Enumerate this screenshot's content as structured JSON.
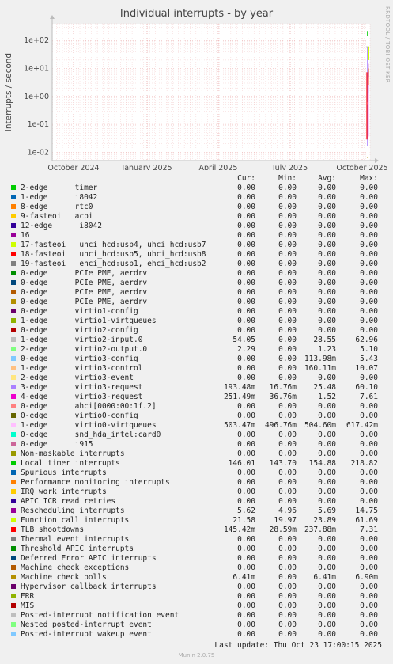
{
  "chart_data": {
    "type": "line",
    "title": "Individual interrupts - by year",
    "ylabel": "interrupts / second",
    "yscale": "log",
    "ylim": [
      0.005,
      400
    ],
    "y_ticks": [
      "1e+02",
      "1e+01",
      "1e+00",
      "1e-01",
      "1e-02"
    ],
    "x_ticks": [
      "October 2024",
      "January 2025",
      "April 2025",
      "July 2025",
      "October 2025"
    ],
    "columns": [
      "Cur:",
      "Min:",
      "Avg:",
      "Max:"
    ],
    "series": [
      {
        "name": "2-edge      timer",
        "color": "#00cc00",
        "cur": "0.00",
        "min": "0.00",
        "avg": "0.00",
        "max": "0.00"
      },
      {
        "name": "1-edge      i8042",
        "color": "#0066b3",
        "cur": "0.00",
        "min": "0.00",
        "avg": "0.00",
        "max": "0.00"
      },
      {
        "name": "8-edge      rtc0",
        "color": "#ff8000",
        "cur": "0.00",
        "min": "0.00",
        "avg": "0.00",
        "max": "0.00"
      },
      {
        "name": "9-fasteoi   acpi",
        "color": "#ffcc00",
        "cur": "0.00",
        "min": "0.00",
        "avg": "0.00",
        "max": "0.00"
      },
      {
        "name": "12-edge      i8042",
        "color": "#330099",
        "cur": "0.00",
        "min": "0.00",
        "avg": "0.00",
        "max": "0.00"
      },
      {
        "name": "16",
        "color": "#990099",
        "cur": "0.00",
        "min": "0.00",
        "avg": "0.00",
        "max": "0.00"
      },
      {
        "name": "17-fasteoi   uhci_hcd:usb4, uhci_hcd:usb7",
        "color": "#ccff00",
        "cur": "0.00",
        "min": "0.00",
        "avg": "0.00",
        "max": "0.00"
      },
      {
        "name": "18-fasteoi   uhci_hcd:usb5, uhci_hcd:usb8",
        "color": "#ff0000",
        "cur": "0.00",
        "min": "0.00",
        "avg": "0.00",
        "max": "0.00"
      },
      {
        "name": "19-fasteoi   ehci_hcd:usb1, ehci_hcd:usb2",
        "color": "#808080",
        "cur": "0.00",
        "min": "0.00",
        "avg": "0.00",
        "max": "0.00"
      },
      {
        "name": "0-edge      PCIe PME, aerdrv",
        "color": "#008f00",
        "cur": "0.00",
        "min": "0.00",
        "avg": "0.00",
        "max": "0.00"
      },
      {
        "name": "0-edge      PCIe PME, aerdrv",
        "color": "#00487d",
        "cur": "0.00",
        "min": "0.00",
        "avg": "0.00",
        "max": "0.00"
      },
      {
        "name": "0-edge      PCIe PME, aerdrv",
        "color": "#b35a00",
        "cur": "0.00",
        "min": "0.00",
        "avg": "0.00",
        "max": "0.00"
      },
      {
        "name": "0-edge      PCIe PME, aerdrv",
        "color": "#b38f00",
        "cur": "0.00",
        "min": "0.00",
        "avg": "0.00",
        "max": "0.00"
      },
      {
        "name": "0-edge      virtio1-config",
        "color": "#6b006b",
        "cur": "0.00",
        "min": "0.00",
        "avg": "0.00",
        "max": "0.00"
      },
      {
        "name": "1-edge      virtio1-virtqueues",
        "color": "#8fb300",
        "cur": "0.00",
        "min": "0.00",
        "avg": "0.00",
        "max": "0.00"
      },
      {
        "name": "0-edge      virtio2-config",
        "color": "#b30000",
        "cur": "0.00",
        "min": "0.00",
        "avg": "0.00",
        "max": "0.00"
      },
      {
        "name": "1-edge      virtio2-input.0",
        "color": "#bebebe",
        "cur": "54.05",
        "min": "0.00",
        "avg": "28.55",
        "max": "62.96"
      },
      {
        "name": "2-edge      virtio2-output.0",
        "color": "#80ff80",
        "cur": "2.29",
        "min": "0.00",
        "avg": "1.23",
        "max": "5.10"
      },
      {
        "name": "0-edge      virtio3-config",
        "color": "#80c9ff",
        "cur": "0.00",
        "min": "0.00",
        "avg": "113.98m",
        "max": "5.43"
      },
      {
        "name": "1-edge      virtio3-control",
        "color": "#ffc080",
        "cur": "0.00",
        "min": "0.00",
        "avg": "160.11m",
        "max": "10.07"
      },
      {
        "name": "2-edge      virtio3-event",
        "color": "#ffe680",
        "cur": "0.00",
        "min": "0.00",
        "avg": "0.00",
        "max": "0.00"
      },
      {
        "name": "3-edge      virtio3-request",
        "color": "#aa80ff",
        "cur": "193.48m",
        "min": "16.76m",
        "avg": "25.48",
        "max": "60.10"
      },
      {
        "name": "4-edge      virtio3-request",
        "color": "#ee00cc",
        "cur": "251.49m",
        "min": "36.76m",
        "avg": "1.52",
        "max": "7.61"
      },
      {
        "name": "0-edge      ahci[0000:00:1f.2]",
        "color": "#ff8080",
        "cur": "0.00",
        "min": "0.00",
        "avg": "0.00",
        "max": "0.00"
      },
      {
        "name": "0-edge      virtio0-config",
        "color": "#666600",
        "cur": "0.00",
        "min": "0.00",
        "avg": "0.00",
        "max": "0.00"
      },
      {
        "name": "1-edge      virtio0-virtqueues",
        "color": "#ffbfff",
        "cur": "503.47m",
        "min": "496.76m",
        "avg": "504.60m",
        "max": "617.42m"
      },
      {
        "name": "0-edge      snd_hda_intel:card0",
        "color": "#00ffcc",
        "cur": "0.00",
        "min": "0.00",
        "avg": "0.00",
        "max": "0.00"
      },
      {
        "name": "0-edge      i915",
        "color": "#cc6699",
        "cur": "0.00",
        "min": "0.00",
        "avg": "0.00",
        "max": "0.00"
      },
      {
        "name": "Non-maskable interrupts",
        "color": "#999900",
        "cur": "0.00",
        "min": "0.00",
        "avg": "0.00",
        "max": "0.00"
      },
      {
        "name": "Local timer interrupts",
        "color": "#00cc00",
        "cur": "146.01",
        "min": "143.70",
        "avg": "154.88",
        "max": "218.82"
      },
      {
        "name": "Spurious interrupts",
        "color": "#0066b3",
        "cur": "0.00",
        "min": "0.00",
        "avg": "0.00",
        "max": "0.00"
      },
      {
        "name": "Performance monitoring interrupts",
        "color": "#ff8000",
        "cur": "0.00",
        "min": "0.00",
        "avg": "0.00",
        "max": "0.00"
      },
      {
        "name": "IRQ work interrupts",
        "color": "#ffcc00",
        "cur": "0.00",
        "min": "0.00",
        "avg": "0.00",
        "max": "0.00"
      },
      {
        "name": "APIC ICR read retries",
        "color": "#330099",
        "cur": "0.00",
        "min": "0.00",
        "avg": "0.00",
        "max": "0.00"
      },
      {
        "name": "Rescheduling interrupts",
        "color": "#990099",
        "cur": "5.62",
        "min": "4.96",
        "avg": "5.69",
        "max": "14.75"
      },
      {
        "name": "Function call interrupts",
        "color": "#ccff00",
        "cur": "21.58",
        "min": "19.97",
        "avg": "23.89",
        "max": "61.69"
      },
      {
        "name": "TLB shootdowns",
        "color": "#ff0000",
        "cur": "145.42m",
        "min": "28.59m",
        "avg": "237.88m",
        "max": "7.31"
      },
      {
        "name": "Thermal event interrupts",
        "color": "#808080",
        "cur": "0.00",
        "min": "0.00",
        "avg": "0.00",
        "max": "0.00"
      },
      {
        "name": "Threshold APIC interrupts",
        "color": "#008f00",
        "cur": "0.00",
        "min": "0.00",
        "avg": "0.00",
        "max": "0.00"
      },
      {
        "name": "Deferred Error APIC interrupts",
        "color": "#00487d",
        "cur": "0.00",
        "min": "0.00",
        "avg": "0.00",
        "max": "0.00"
      },
      {
        "name": "Machine check exceptions",
        "color": "#b35a00",
        "cur": "0.00",
        "min": "0.00",
        "avg": "0.00",
        "max": "0.00"
      },
      {
        "name": "Machine check polls",
        "color": "#b38f00",
        "cur": "6.41m",
        "min": "0.00",
        "avg": "6.41m",
        "max": "6.90m"
      },
      {
        "name": "Hypervisor callback interrupts",
        "color": "#6b006b",
        "cur": "0.00",
        "min": "0.00",
        "avg": "0.00",
        "max": "0.00"
      },
      {
        "name": "ERR",
        "color": "#8fb300",
        "cur": "0.00",
        "min": "0.00",
        "avg": "0.00",
        "max": "0.00"
      },
      {
        "name": "MIS",
        "color": "#b30000",
        "cur": "0.00",
        "min": "0.00",
        "avg": "0.00",
        "max": "0.00"
      },
      {
        "name": "Posted-interrupt notification event",
        "color": "#bebebe",
        "cur": "0.00",
        "min": "0.00",
        "avg": "0.00",
        "max": "0.00"
      },
      {
        "name": "Nested posted-interrupt event",
        "color": "#80ff80",
        "cur": "0.00",
        "min": "0.00",
        "avg": "0.00",
        "max": "0.00"
      },
      {
        "name": "Posted-interrupt wakeup event",
        "color": "#80c9ff",
        "cur": "0.00",
        "min": "0.00",
        "avg": "0.00",
        "max": "0.00"
      }
    ]
  },
  "side_label": "RRDTOOL / TOBI OETIKER",
  "last_update": "Last update: Thu Oct 23 17:00:15 2025",
  "footer": "Munin 2.0.75",
  "colors": {
    "grid": "#e8a0a0",
    "background": "#f0f0f0",
    "plot_background": "#ffffff"
  }
}
